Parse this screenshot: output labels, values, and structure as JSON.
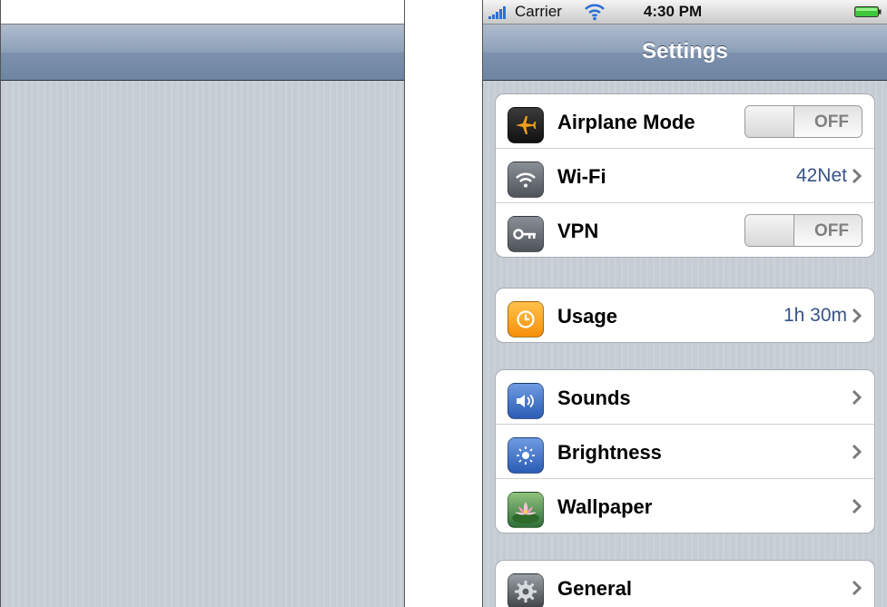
{
  "right": {
    "status": {
      "carrier": "Carrier",
      "time": "4:30 PM"
    },
    "nav": {
      "title": "Settings"
    },
    "rows": {
      "airplane": {
        "label": "Airplane Mode",
        "switch": "OFF"
      },
      "wifi": {
        "label": "Wi-Fi",
        "value": "42Net"
      },
      "vpn": {
        "label": "VPN",
        "switch": "OFF"
      },
      "usage": {
        "label": "Usage",
        "value": "1h 30m"
      },
      "sounds": {
        "label": "Sounds"
      },
      "brightness": {
        "label": "Brightness"
      },
      "wallpaper": {
        "label": "Wallpaper"
      },
      "general": {
        "label": "General"
      }
    }
  },
  "colors": {
    "nav_bar": "#7d91ad",
    "background": "#c5ccd4",
    "value_text": "#385487",
    "usage_icon": "#f7a21b",
    "airplane_icon": "#e8861c"
  },
  "icons": [
    "signal-bars-icon",
    "wifi-icon",
    "battery-icon",
    "airplane-icon",
    "key-icon",
    "clock-icon",
    "speaker-icon",
    "sun-icon",
    "flower-icon",
    "gear-icon",
    "chevron-right-icon"
  ]
}
